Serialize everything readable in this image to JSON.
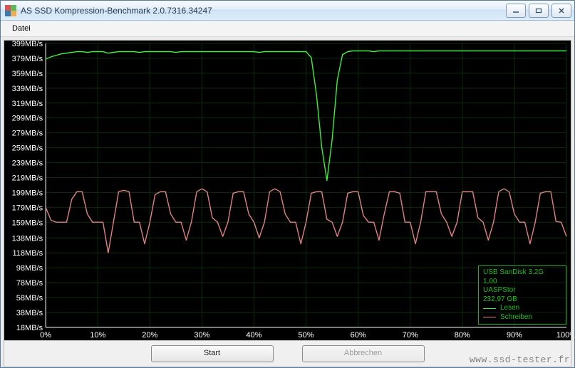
{
  "window": {
    "title": "AS SSD Kompression-Benchmark 2.0.7316.34247",
    "min_tooltip": "Minimize",
    "max_tooltip": "Maximize",
    "close_tooltip": "Close"
  },
  "menu": {
    "file": "Datei"
  },
  "buttons": {
    "start": "Start",
    "abort": "Abbrechen"
  },
  "watermark": "www.ssd-tester.fr",
  "legend": {
    "device": "USB  SanDisk 3.2G",
    "version": "1,00",
    "driver": "UASPStor",
    "capacity": "232,97 GB",
    "read_label": "Lesen",
    "write_label": "Schreiben",
    "read_color": "#3cf03c",
    "write_color": "#e08080"
  },
  "chart_data": {
    "type": "line",
    "xlabel": "",
    "ylabel": "",
    "x_unit": "%",
    "y_unit": "MB/s",
    "xlim": [
      0,
      100
    ],
    "ylim": [
      18,
      399
    ],
    "y_ticks": [
      399,
      379,
      359,
      339,
      319,
      299,
      279,
      259,
      239,
      219,
      199,
      179,
      159,
      138,
      118,
      98,
      78,
      58,
      38,
      18
    ],
    "x_ticks": [
      0,
      10,
      20,
      30,
      40,
      50,
      60,
      70,
      80,
      90,
      100
    ],
    "series": [
      {
        "name": "Lesen",
        "color": "#3cf03c",
        "x": [
          0,
          1,
          2,
          3,
          4,
          5,
          6,
          7,
          8,
          9,
          10,
          11,
          12,
          13,
          14,
          15,
          16,
          17,
          18,
          19,
          20,
          21,
          22,
          23,
          24,
          25,
          26,
          27,
          28,
          29,
          30,
          31,
          32,
          33,
          34,
          35,
          36,
          37,
          38,
          39,
          40,
          41,
          42,
          43,
          44,
          45,
          46,
          47,
          48,
          49,
          50,
          51,
          52,
          53,
          54,
          55,
          56,
          57,
          58,
          59,
          60,
          61,
          62,
          63,
          64,
          65,
          66,
          67,
          68,
          69,
          70,
          71,
          72,
          73,
          74,
          75,
          76,
          77,
          78,
          79,
          80,
          81,
          82,
          83,
          84,
          85,
          86,
          87,
          88,
          89,
          90,
          91,
          92,
          93,
          94,
          95,
          96,
          97,
          98,
          99,
          100
        ],
        "values": [
          378,
          381,
          383,
          385,
          386,
          387,
          388,
          388,
          387,
          388,
          388,
          388,
          386,
          387,
          388,
          388,
          388,
          388,
          387,
          388,
          388,
          388,
          388,
          388,
          388,
          387,
          388,
          388,
          388,
          388,
          388,
          388,
          388,
          388,
          388,
          388,
          388,
          388,
          388,
          388,
          388,
          387,
          388,
          388,
          388,
          388,
          388,
          388,
          388,
          388,
          388,
          380,
          330,
          260,
          215,
          270,
          350,
          384,
          388,
          389,
          389,
          389,
          389,
          388,
          389,
          389,
          389,
          389,
          389,
          389,
          389,
          389,
          389,
          389,
          389,
          389,
          389,
          389,
          389,
          389,
          389,
          389,
          389,
          389,
          389,
          389,
          389,
          389,
          389,
          389,
          389,
          389,
          389,
          389,
          389,
          389,
          389,
          389,
          389,
          389,
          389
        ]
      },
      {
        "name": "Schreiben",
        "color": "#e08080",
        "x": [
          0,
          1,
          2,
          3,
          4,
          5,
          6,
          7,
          8,
          9,
          10,
          11,
          12,
          13,
          14,
          15,
          16,
          17,
          18,
          19,
          20,
          21,
          22,
          23,
          24,
          25,
          26,
          27,
          28,
          29,
          30,
          31,
          32,
          33,
          34,
          35,
          36,
          37,
          38,
          39,
          40,
          41,
          42,
          43,
          44,
          45,
          46,
          47,
          48,
          49,
          50,
          51,
          52,
          53,
          54,
          55,
          56,
          57,
          58,
          59,
          60,
          61,
          62,
          63,
          64,
          65,
          66,
          67,
          68,
          69,
          70,
          71,
          72,
          73,
          74,
          75,
          76,
          77,
          78,
          79,
          80,
          81,
          82,
          83,
          84,
          85,
          86,
          87,
          88,
          89,
          90,
          91,
          92,
          93,
          94,
          95,
          96,
          97,
          98,
          99,
          100
        ],
        "values": [
          179,
          162,
          159,
          159,
          159,
          190,
          200,
          200,
          170,
          159,
          159,
          159,
          118,
          159,
          200,
          202,
          200,
          159,
          159,
          130,
          159,
          196,
          200,
          200,
          170,
          159,
          159,
          135,
          160,
          200,
          204,
          200,
          165,
          159,
          140,
          159,
          198,
          200,
          200,
          170,
          159,
          138,
          159,
          200,
          204,
          200,
          170,
          159,
          159,
          130,
          159,
          198,
          200,
          200,
          163,
          159,
          140,
          159,
          198,
          200,
          200,
          168,
          159,
          159,
          135,
          170,
          200,
          200,
          198,
          159,
          159,
          130,
          159,
          200,
          200,
          200,
          170,
          159,
          140,
          159,
          200,
          200,
          200,
          165,
          159,
          135,
          159,
          200,
          204,
          200,
          170,
          159,
          159,
          130,
          159,
          198,
          200,
          200,
          160,
          159,
          140
        ]
      }
    ]
  }
}
